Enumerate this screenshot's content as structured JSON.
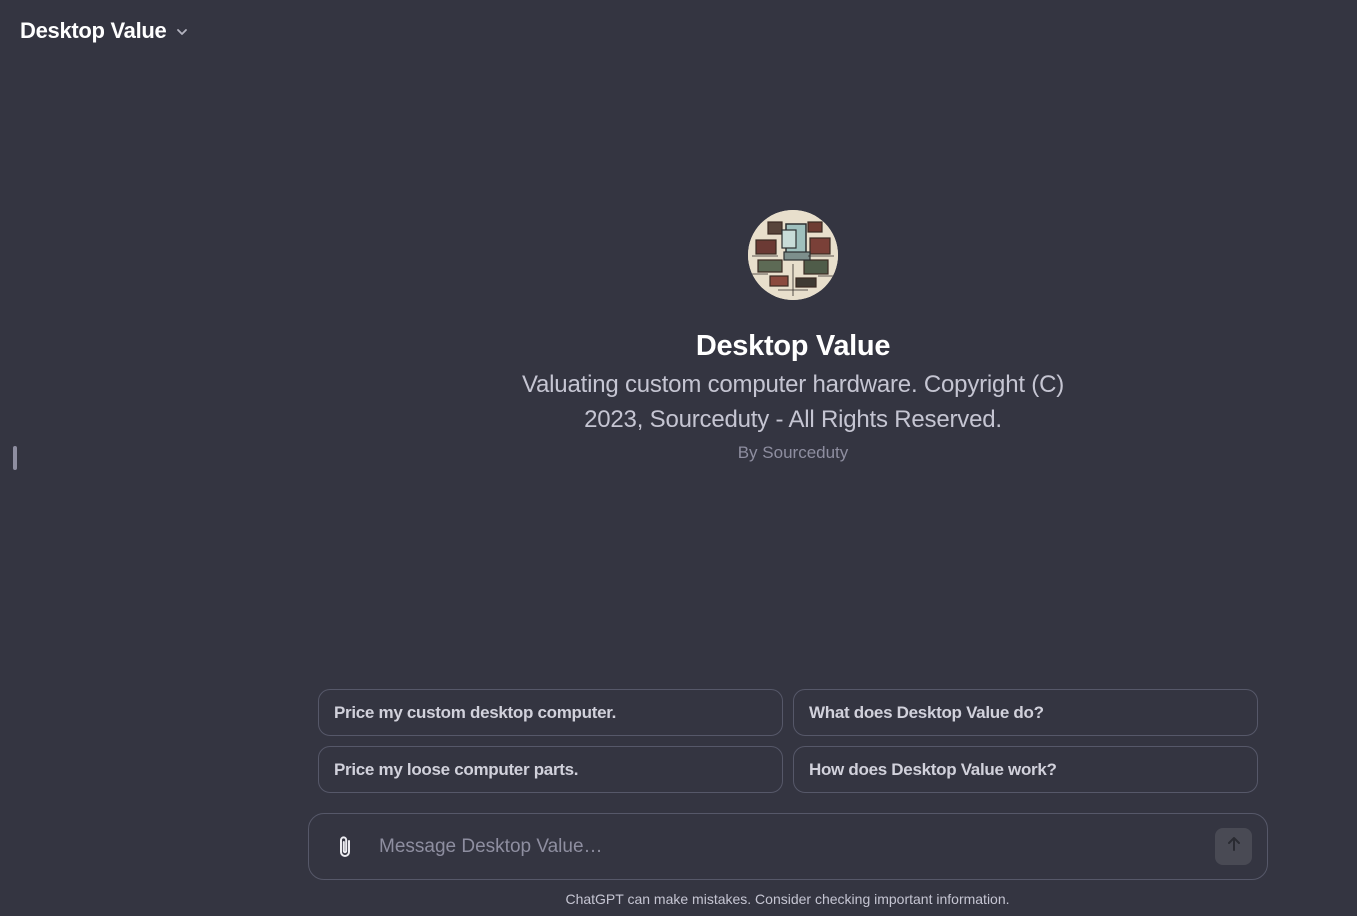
{
  "header": {
    "model_name": "Desktop Value",
    "chevron_icon": "chevron-down-icon"
  },
  "gpt": {
    "avatar_icon": "computer-circuit-avatar",
    "title": "Desktop Value",
    "description": "Valuating custom computer hardware. Copyright (C) 2023, Sourceduty - All Rights Reserved.",
    "author": "By Sourceduty"
  },
  "suggestions": [
    "Price my custom desktop computer.",
    "What does Desktop Value do?",
    "Price my loose computer parts.",
    "How does Desktop Value work?"
  ],
  "composer": {
    "placeholder": "Message Desktop Value…",
    "attach_icon": "paperclip-icon",
    "send_icon": "arrow-up-icon"
  },
  "footer": {
    "disclaimer": "ChatGPT can make mistakes. Consider checking important information."
  },
  "colors": {
    "background": "#343541",
    "border": "#565869",
    "text_primary": "#ffffff",
    "text_secondary": "#c5c5d2",
    "text_muted": "#8e8ea0"
  }
}
